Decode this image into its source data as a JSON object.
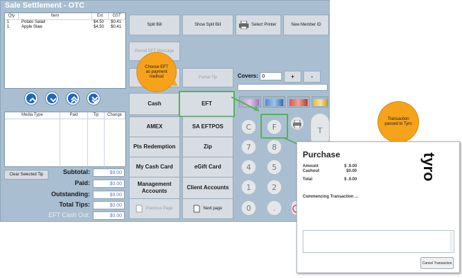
{
  "window": {
    "title": "Sale Settlement - OTC"
  },
  "items_table": {
    "headers": [
      "Qty",
      "Item",
      "Ext",
      "GST"
    ],
    "rows": [
      {
        "qty": "1",
        "item": "Potato Salad",
        "ext": "$4.50",
        "gst": "$0.41"
      },
      {
        "qty": "1",
        "item": "Apple Slaw",
        "ext": "$4.50",
        "gst": "$0.41"
      }
    ]
  },
  "media_table": {
    "headers": [
      "Media Type",
      "Paid",
      "Tip",
      "Change"
    ]
  },
  "clear_tip": "Clear Selected Tip",
  "totals": {
    "subtotal_label": "Subtotal:",
    "subtotal": "$9.00",
    "paid_label": "Paid:",
    "paid": "$0.00",
    "outstanding_label": "Outstanding:",
    "outstanding": "$9.00",
    "tips_label": "Total Tips:",
    "tips": "$0.00",
    "eft_label": "EFT Cash Out:",
    "eft": "$0.00"
  },
  "top_buttons": {
    "split_bill": "Split Bill",
    "show_split_bill": "Show Split Bill",
    "select_printer": "Select Printer",
    "new_member_id": "New Member ID"
  },
  "resend": "Resnd EFT Message",
  "partial_tip": "Partial Tip",
  "payments": {
    "cash": "Cash",
    "eft": "EFT",
    "amex": "AMEX",
    "sa_eftpos": "SA EFTPOS",
    "pts": "Pts Redemption",
    "zip": "Zip",
    "my_cash_card": "My Cash Card",
    "egift": "eGift Card",
    "mgmt": "Management Accounts",
    "client": "Client Accounts",
    "prev": "Previous Page",
    "next": "Next page"
  },
  "covers": {
    "label": "Covers:",
    "value": "0",
    "plus": "+",
    "minus": "-"
  },
  "keypad": {
    "c": "C",
    "f": "F",
    "t": "T",
    "k7": "7",
    "k8": "8",
    "k4": "4",
    "k5": "5",
    "k1": "1",
    "k2": "2",
    "k0": "0",
    "dot": "."
  },
  "callouts": {
    "choose": "Choose EFT as payment method",
    "tyro_passed": "Transaction passed to Tyro"
  },
  "tyro": {
    "heading": "Purchase",
    "amount_label": "Amount",
    "amount": "$ .9.00",
    "cashout_label": "Cashout",
    "cashout": "$0.00",
    "total_label": "Total",
    "total": "$ .9.00",
    "status": "Commencing Transaction ...",
    "cancel": "Cancel Transaction",
    "logo": "tyro"
  },
  "colors": {
    "window_bg": "#a9bfd1",
    "accent_blue": "#1e67c0",
    "callout_orange": "#f6a21b",
    "highlight_green": "#55b05a"
  }
}
